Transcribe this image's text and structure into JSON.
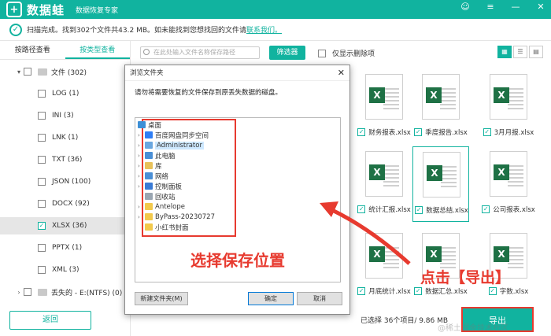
{
  "app": {
    "logo_glyph": "+",
    "name": "数据蛙",
    "subtitle": "数据恢复专家",
    "win_controls": [
      "☺",
      "≡",
      "—",
      "✕"
    ]
  },
  "status": {
    "text": "扫描完成。找到302个文件共43.2 MB。如未能找到您想找回的文件请",
    "link": "联系我们。"
  },
  "left": {
    "tabs": [
      "按路径查看",
      "按类型查看"
    ],
    "active_tab": 1,
    "tree": [
      {
        "label": "文件 (302)",
        "checked": false,
        "caret": "▾",
        "level": 0
      },
      {
        "label": "LOG (1)",
        "checked": false,
        "level": 1
      },
      {
        "label": "INI (3)",
        "checked": false,
        "level": 1
      },
      {
        "label": "LNK (1)",
        "checked": false,
        "level": 1
      },
      {
        "label": "TXT (36)",
        "checked": false,
        "level": 1
      },
      {
        "label": "JSON (100)",
        "checked": false,
        "level": 1
      },
      {
        "label": "DOCX (92)",
        "checked": false,
        "level": 1
      },
      {
        "label": "XLSX (36)",
        "checked": true,
        "level": 1,
        "selected": true
      },
      {
        "label": "PPTX (1)",
        "checked": false,
        "level": 1
      },
      {
        "label": "XML (3)",
        "checked": false,
        "level": 1
      },
      {
        "label": "丢失的 - E:(NTFS) (0)",
        "checked": false,
        "caret": "›",
        "level": 0
      }
    ],
    "back_label": "返回"
  },
  "toolbar": {
    "search_placeholder": "在此处输入文件名称保存路径",
    "filter_label": "筛选器",
    "only_deleted": "仅显示删除项",
    "views": [
      "▦",
      "☰",
      "▤"
    ]
  },
  "files": [
    {
      "name": "财务报表.xlsx",
      "checked": true
    },
    {
      "name": "季度报告.xlsx",
      "checked": true
    },
    {
      "name": "3月月报.xlsx",
      "checked": true
    },
    {
      "name": "统计汇报.xlsx",
      "checked": true
    },
    {
      "name": "数据总结.xlsx",
      "checked": true
    },
    {
      "name": "公司报表.xlsx",
      "checked": true
    },
    {
      "name": "月底统计.xlsx",
      "checked": true
    },
    {
      "name": "数据汇总.xlsx",
      "checked": true
    },
    {
      "name": "字数.xlsx",
      "checked": true
    }
  ],
  "bottom": {
    "selected_info": "已选择 36个项目/ 9.86 MB",
    "export_label": "导出",
    "watermark": "@稀土掘金技术社区"
  },
  "dialog": {
    "title": "浏览文件夹",
    "prompt": "请勿将需要恢复的文件保存到原丢失数据的磁盘。",
    "items": [
      {
        "label": "桌面",
        "color": "#3d8fd6",
        "arrow": ""
      },
      {
        "label": "百度网盘同步空间",
        "color": "#2f7ef5",
        "arrow": "›"
      },
      {
        "label": "Administrator",
        "color": "#6aa7e0",
        "arrow": "›",
        "selected": true
      },
      {
        "label": "此电脑",
        "color": "#4a8fd6",
        "arrow": "›"
      },
      {
        "label": "库",
        "color": "#e8c15a",
        "arrow": "›"
      },
      {
        "label": "网络",
        "color": "#4a8fd6",
        "arrow": "›"
      },
      {
        "label": "控制面板",
        "color": "#3a7bd5",
        "arrow": "›"
      },
      {
        "label": "回收站",
        "color": "#9aa6b2",
        "arrow": ""
      },
      {
        "label": "Antelope",
        "color": "#f2c94c",
        "arrow": "›"
      },
      {
        "label": "ByPass-20230727",
        "color": "#f2c94c",
        "arrow": "›"
      },
      {
        "label": "小红书封面",
        "color": "#f2c94c",
        "arrow": ""
      }
    ],
    "new_folder": "新建文件夹(M)",
    "ok": "确定",
    "cancel": "取消"
  },
  "annotations": {
    "choose_location": "选择保存位置",
    "click_export": "点击【导出】"
  },
  "colors": {
    "brand": "#11b39f",
    "annotation": "#e73a2f",
    "excel": "#1e7145"
  }
}
